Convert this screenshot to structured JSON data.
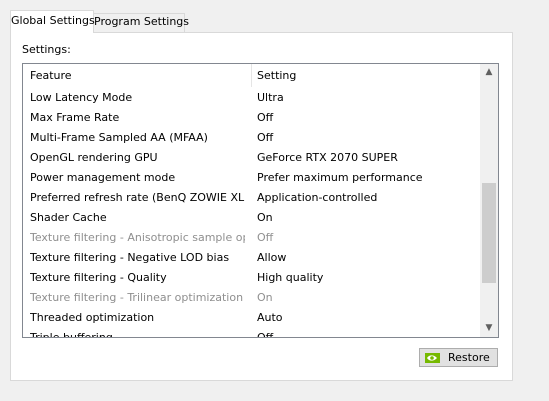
{
  "tabs": [
    {
      "label": "Global Settings",
      "active": true
    },
    {
      "label": "Program Settings",
      "active": false
    }
  ],
  "settings_label": "Settings:",
  "grid": {
    "columns": [
      "Feature",
      "Setting"
    ],
    "rows": [
      {
        "feature": "Low Latency Mode",
        "setting": "Ultra",
        "enabled": true
      },
      {
        "feature": "Max Frame Rate",
        "setting": "Off",
        "enabled": true
      },
      {
        "feature": "Multi-Frame Sampled AA (MFAA)",
        "setting": "Off",
        "enabled": true
      },
      {
        "feature": "OpenGL rendering GPU",
        "setting": "GeForce RTX 2070 SUPER",
        "enabled": true
      },
      {
        "feature": "Power management mode",
        "setting": "Prefer maximum performance",
        "enabled": true
      },
      {
        "feature": "Preferred refresh rate (BenQ ZOWIE XL L...",
        "setting": "Application-controlled",
        "enabled": true
      },
      {
        "feature": "Shader Cache",
        "setting": "On",
        "enabled": true
      },
      {
        "feature": "Texture filtering - Anisotropic sample opti...",
        "setting": "Off",
        "enabled": false
      },
      {
        "feature": "Texture filtering - Negative LOD bias",
        "setting": "Allow",
        "enabled": true
      },
      {
        "feature": "Texture filtering - Quality",
        "setting": "High quality",
        "enabled": true
      },
      {
        "feature": "Texture filtering - Trilinear optimization",
        "setting": "On",
        "enabled": false
      },
      {
        "feature": "Threaded optimization",
        "setting": "Auto",
        "enabled": true
      },
      {
        "feature": "Triple buffering",
        "setting": "Off",
        "enabled": true
      }
    ]
  },
  "scrollbar": {
    "up_icon": "chevron-up-icon",
    "down_icon": "chevron-down-icon",
    "position": 0.65
  },
  "restore_button": {
    "label": "Restore",
    "icon": "nvidia-logo-icon"
  },
  "colors": {
    "accent_green": "#76b900",
    "disabled_text": "#8f8f8f"
  }
}
